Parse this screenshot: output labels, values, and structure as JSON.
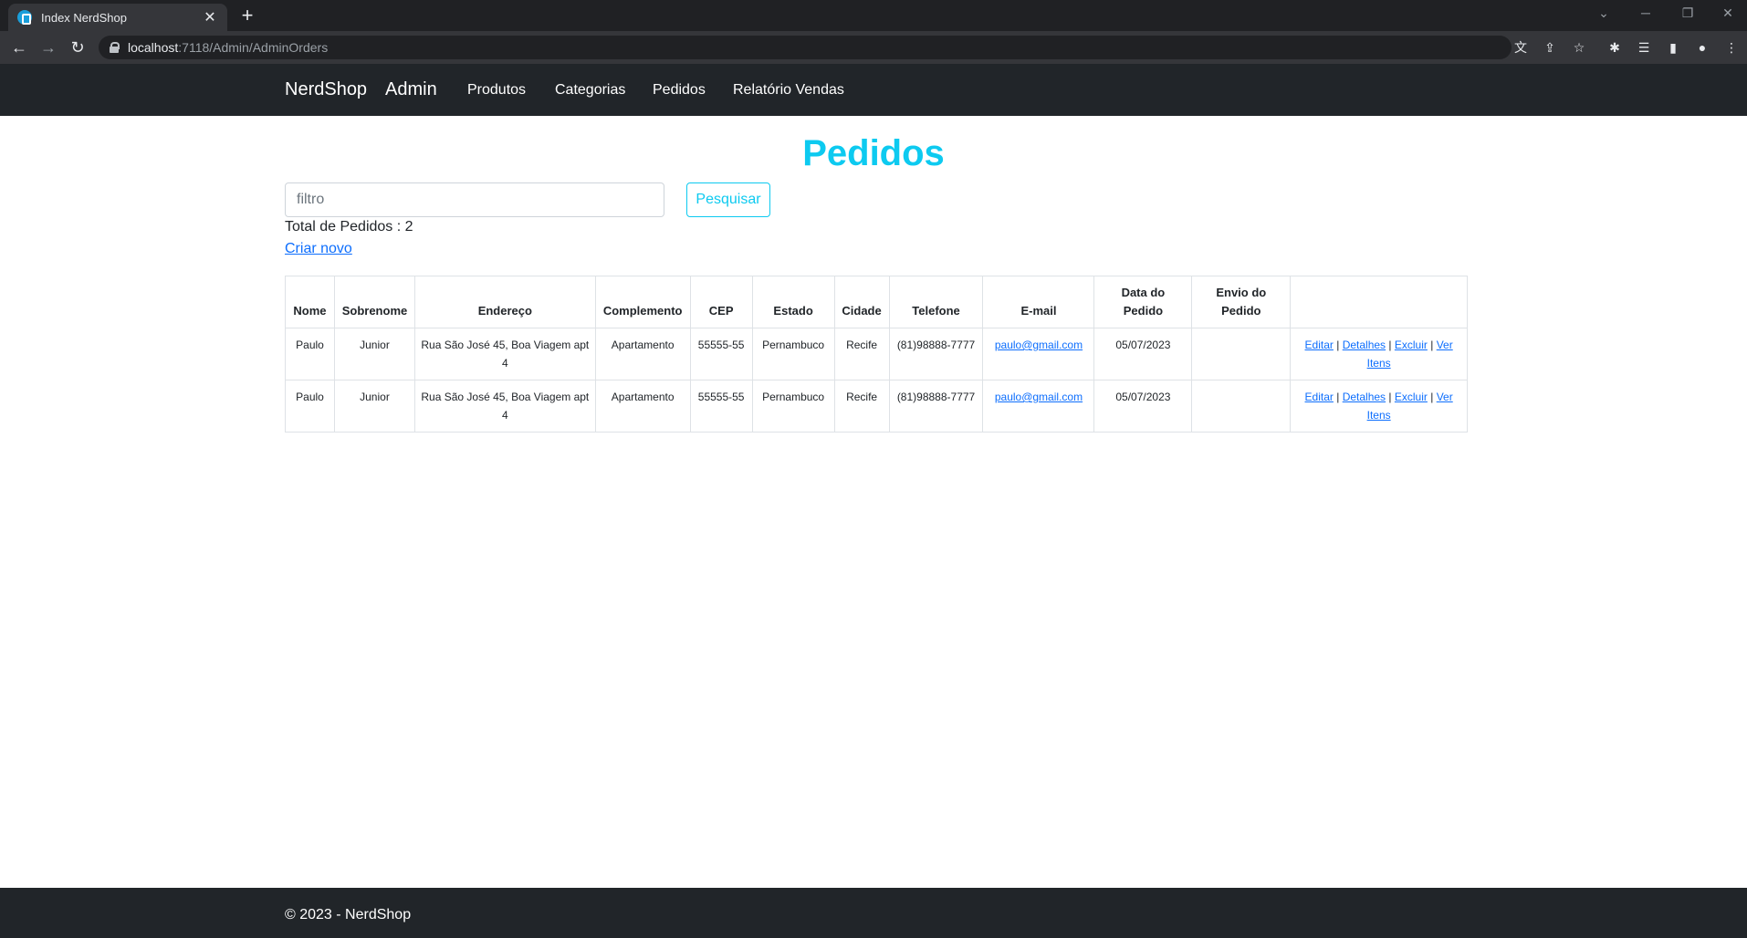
{
  "browser": {
    "tab_title": "Index NerdShop",
    "tab_close": "✕",
    "new_tab": "+",
    "url_host": "localhost",
    "url_path": ":7118/Admin/AdminOrders"
  },
  "navbar": {
    "brand": "NerdShop",
    "admin": "Admin",
    "links": [
      "Produtos",
      "Categorias",
      "Pedidos",
      "Relatório Vendas"
    ]
  },
  "page": {
    "title": "Pedidos",
    "filter_placeholder": "filtro",
    "search_button": "Pesquisar",
    "total": "Total de Pedidos : 2",
    "create_link": "Criar novo"
  },
  "table": {
    "headers": {
      "nome": "Nome",
      "sobrenome": "Sobrenome",
      "endereco": "Endereço",
      "complemento": "Complemento",
      "cep": "CEP",
      "estado": "Estado",
      "cidade": "Cidade",
      "telefone": "Telefone",
      "email": "E-mail",
      "data": "Data do Pedido",
      "envio": "Envio do Pedido"
    },
    "rows": [
      {
        "nome": "Paulo",
        "sobrenome": "Junior",
        "endereco": "Rua São José 45, Boa Viagem apt 4",
        "complemento": "Apartamento",
        "cep": "55555-55",
        "estado": "Pernambuco",
        "cidade": "Recife",
        "telefone": "(81)98888-7777",
        "email": "paulo@gmail.com",
        "data": "05/07/2023",
        "envio": ""
      },
      {
        "nome": "Paulo",
        "sobrenome": "Junior",
        "endereco": "Rua São José 45, Boa Viagem apt 4",
        "complemento": "Apartamento",
        "cep": "55555-55",
        "estado": "Pernambuco",
        "cidade": "Recife",
        "telefone": "(81)98888-7777",
        "email": "paulo@gmail.com",
        "data": "05/07/2023",
        "envio": ""
      }
    ],
    "actions": {
      "edit": "Editar",
      "details": "Detalhes",
      "delete": "Excluir",
      "items": "Ver Itens",
      "separator": "|"
    }
  },
  "footer": {
    "text": "© 2023 - NerdShop"
  },
  "colors": {
    "title": "#0dcaf0",
    "navbar": "#212529",
    "link": "#0d6efd"
  }
}
